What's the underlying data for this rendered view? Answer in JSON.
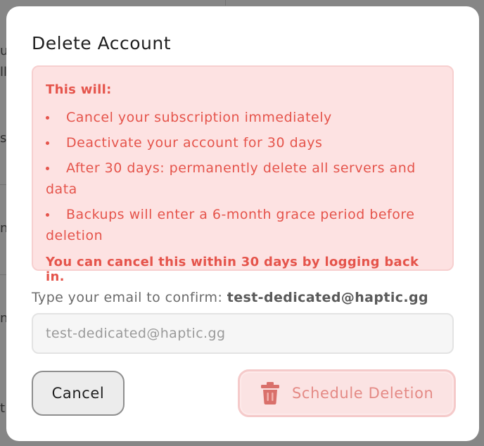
{
  "background": {
    "fragments": [
      "u",
      "lle",
      "s",
      "ni",
      "ng",
      "t"
    ]
  },
  "modal": {
    "title": "Delete Account",
    "warning": {
      "heading": "This will:",
      "items": [
        "Cancel your subscription immediately",
        "Deactivate your account for 30 days",
        "After 30 days: permanently delete all servers and data",
        "Backups will enter a 6-month grace period before deletion"
      ],
      "footer": "You can cancel this within 30 days by logging back in."
    },
    "confirm": {
      "label": "Type your email to confirm:",
      "email": "test-dedicated@haptic.gg",
      "placeholder": "test-dedicated@haptic.gg"
    },
    "buttons": {
      "cancel": "Cancel",
      "schedule_deletion": "Schedule Deletion"
    }
  },
  "colors": {
    "danger": "#e5544b",
    "danger_bg": "#fde2e2",
    "danger_button_text": "#e48a85",
    "icon": "#d9706b"
  },
  "icons": {
    "delete": "trash-icon"
  }
}
